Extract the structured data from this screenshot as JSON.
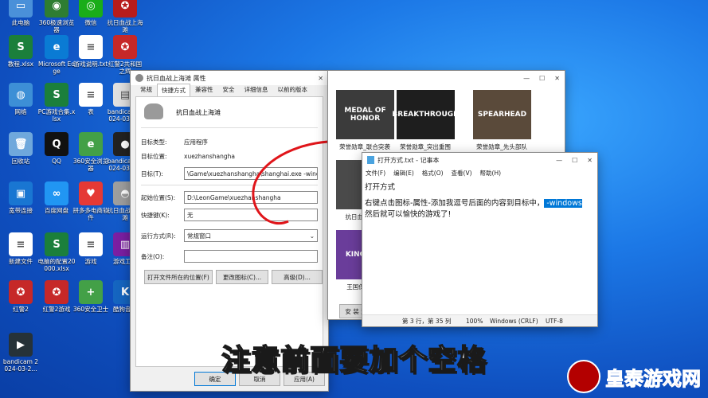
{
  "desktop_icons": [
    {
      "label": "此电脑",
      "color": "#4a90d9",
      "glyph": "▭"
    },
    {
      "label": "360极速浏览器",
      "color": "#2e7d32",
      "glyph": "◉"
    },
    {
      "label": "微信",
      "color": "#1aad19",
      "glyph": "◎"
    },
    {
      "label": "抗日血战上海滩",
      "color": "#b71c1c",
      "glyph": "✪"
    },
    {
      "label": "教程.xlsx",
      "color": "#1b7f3b",
      "glyph": "S"
    },
    {
      "label": "Microsoft Edge",
      "color": "#0a7bd4",
      "glyph": "e"
    },
    {
      "label": "游戏说明.txt",
      "color": "#ffffff",
      "glyph": "≡"
    },
    {
      "label": "红警2共和国之辉",
      "color": "#c62828",
      "glyph": "✪"
    },
    {
      "label": "网络",
      "color": "#3d8fd6",
      "glyph": "◍"
    },
    {
      "label": "PC游戏合集.xlsx",
      "color": "#1b7f3b",
      "glyph": "S"
    },
    {
      "label": "表",
      "color": "#ffffff",
      "glyph": "≡"
    },
    {
      "label": "bandicam 2024-03-2...",
      "color": "#e0e0e0",
      "glyph": "▤"
    },
    {
      "label": "回收站",
      "color": "#6fa8dc",
      "glyph": "🗑"
    },
    {
      "label": "QQ",
      "color": "#111111",
      "glyph": "Q"
    },
    {
      "label": "360安全浏览器",
      "color": "#43a047",
      "glyph": "e"
    },
    {
      "label": "bandicam 2024-03-2...",
      "color": "#222222",
      "glyph": "●"
    },
    {
      "label": "宽带连接",
      "color": "#1976d2",
      "glyph": "▣"
    },
    {
      "label": "百度网盘",
      "color": "#2196f3",
      "glyph": "∞"
    },
    {
      "label": "拼多多电商软件",
      "color": "#e53935",
      "glyph": "♥"
    },
    {
      "label": "抗日血战上海滩",
      "color": "#9e9e9e",
      "glyph": "◓"
    },
    {
      "label": "新建文件",
      "color": "#ffffff",
      "glyph": "≡"
    },
    {
      "label": "电脑的配置20000.xlsx",
      "color": "#1b7f3b",
      "glyph": "S"
    },
    {
      "label": "游戏",
      "color": "#ffffff",
      "glyph": "≡"
    },
    {
      "label": "游戏工具",
      "color": "#7b1fa2",
      "glyph": "▥"
    },
    {
      "label": "红警2",
      "color": "#c62828",
      "glyph": "✪"
    },
    {
      "label": "红警2游戏",
      "color": "#c62828",
      "glyph": "✪"
    },
    {
      "label": "360安全卫士",
      "color": "#43a047",
      "glyph": "+"
    },
    {
      "label": "酷狗音乐",
      "color": "#1565c0",
      "glyph": "K"
    },
    {
      "label": "bandicam 2024-03-2...",
      "color": "#263238",
      "glyph": "▶"
    }
  ],
  "properties_dialog": {
    "title": "抗日血战上海滩 属性",
    "tabs": [
      "常规",
      "快捷方式",
      "兼容性",
      "安全",
      "详细信息",
      "以前的版本"
    ],
    "active_tab": 1,
    "app_name": "抗日血战上海滩",
    "fields": {
      "target_type_label": "目标类型:",
      "target_type": "应用程序",
      "target_location_label": "目标位置:",
      "target_location": "xuezhanshangha",
      "target_label": "目标(T):",
      "target": "\\Game\\xuezhanshangha\\shanghai.exe  -windows",
      "start_in_label": "起始位置(S):",
      "start_in": "D:\\LeonGame\\xuezhanshangha",
      "shortcut_key_label": "快捷键(K):",
      "shortcut_key": "无",
      "run_label": "运行方式(R):",
      "run": "常规窗口",
      "comment_label": "备注(O):",
      "comment": ""
    },
    "buttons": {
      "open_location": "打开文件所在的位置(F)",
      "change_icon": "更改图标(C)...",
      "advanced": "高级(D)...",
      "ok": "确定",
      "cancel": "取消",
      "apply": "应用(A)"
    }
  },
  "explorer": {
    "thumbnails": [
      {
        "label": "荣誉勋章_联合突袭",
        "art": "MEDAL OF HONOR",
        "color": "#3b3b3b"
      },
      {
        "label": "荣誉勋章_突出重围",
        "art": "BREAKTHROUGH",
        "color": "#1e1e1e"
      },
      {
        "label": "荣誉勋章_先头部队",
        "art": "SPEARHEAD",
        "color": "#5a4a3a"
      },
      {
        "label": "抗日血战上海",
        "art": "",
        "color": "#4a4a4a"
      },
      {
        "label": "王国保卫战",
        "art": "KINGDOM",
        "color": "#6a3d9a"
      }
    ],
    "install_button": "安 装 游"
  },
  "notepad": {
    "title": "打开方式.txt - 记事本",
    "menu": [
      "文件(F)",
      "编辑(E)",
      "格式(O)",
      "查看(V)",
      "帮助(H)"
    ],
    "line1": "打开方式",
    "line2": "右键点击图标-属性-添加我逗号后面的内容到目标中，",
    "line2_selected": " -windows",
    "line3": "然后就可以愉快的游戏了!",
    "status": {
      "pos": "第 3 行，第 35 列",
      "zoom": "100%",
      "eol": "Windows (CRLF)",
      "enc": "UTF-8"
    }
  },
  "caption": "注意前面要加个空格",
  "watermark": "皇泰游戏网"
}
